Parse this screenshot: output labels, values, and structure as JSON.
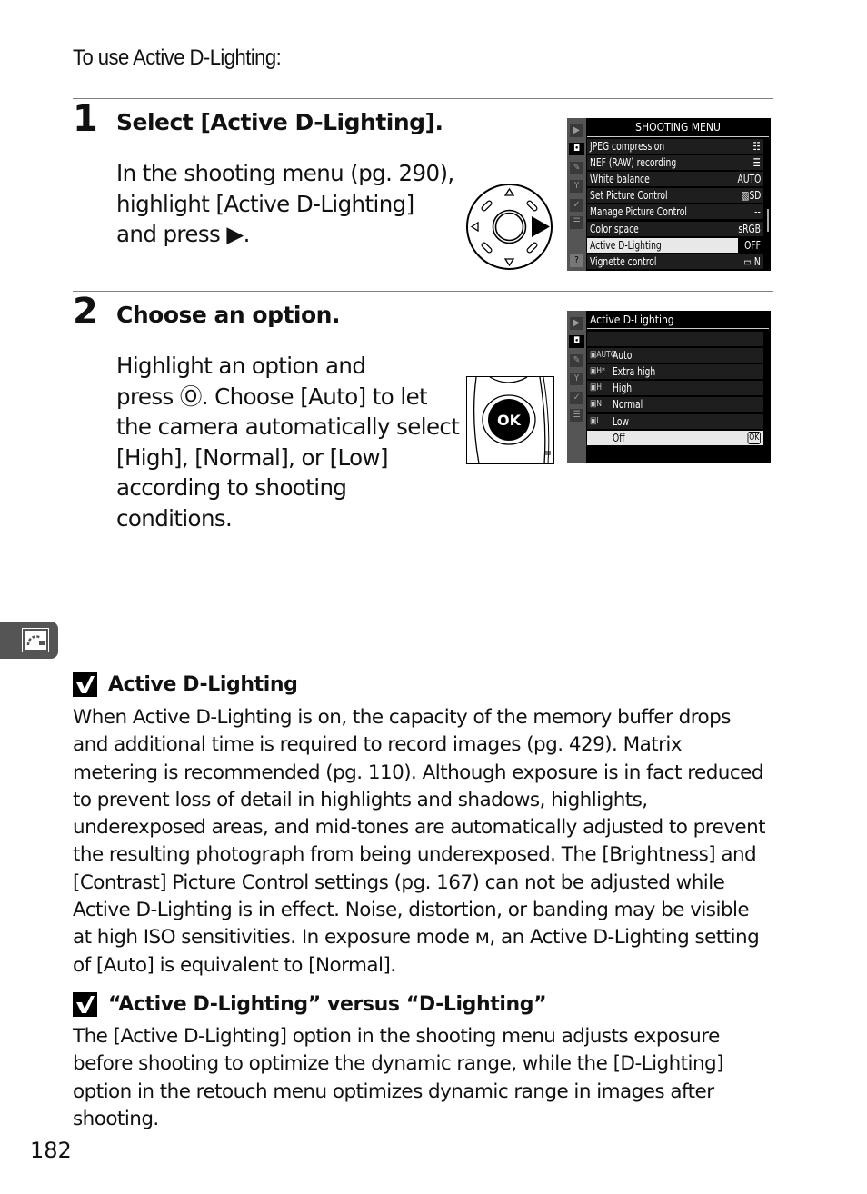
{
  "intro": "To use Active D-Lighting:",
  "steps": [
    {
      "number": "1",
      "title": "Select [Active D-Lighting].",
      "body_lines": [
        "In the shooting menu (pg. 290),",
        "highlight [Active D-Lighting]",
        "and press ▶."
      ]
    },
    {
      "number": "2",
      "title": "Choose an option.",
      "body_lines": [
        "Highlight an option and",
        "press Ⓞ. Choose [Auto] to let",
        "the camera automatically select",
        "[High], [Normal], or [Low]",
        "according to shooting",
        "conditions."
      ]
    }
  ],
  "shooting_menu": {
    "title": "SHOOTING MENU",
    "side_icons": [
      "playback-icon",
      "camera-icon",
      "pencil-icon",
      "wrench-icon",
      "retouch-icon",
      "my-menu-icon",
      "help-icon"
    ],
    "items": [
      {
        "label": "JPEG compression",
        "value": "☷"
      },
      {
        "label": "NEF (RAW) recording",
        "value": "☰"
      },
      {
        "label": "White balance",
        "value": "AUTO"
      },
      {
        "label": "Set Picture Control",
        "value": "▨SD"
      },
      {
        "label": "Manage Picture Control",
        "value": "--"
      },
      {
        "label": "Color space",
        "value": "sRGB"
      },
      {
        "label": "Active D-Lighting",
        "value": "OFF",
        "selected": true
      },
      {
        "label": "Vignette control",
        "value": "▭ N"
      }
    ]
  },
  "adl_menu": {
    "title": "Active D-Lighting",
    "items": [
      {
        "prefix": "▣AUTO",
        "label": "Auto"
      },
      {
        "prefix": "▣H*",
        "label": "Extra high"
      },
      {
        "prefix": "▣H",
        "label": "High"
      },
      {
        "prefix": "▣N",
        "label": "Normal"
      },
      {
        "prefix": "▣L",
        "label": "Low"
      },
      {
        "prefix": "",
        "label": "Off",
        "selected": true,
        "value": "OK"
      }
    ]
  },
  "multi_selector": {
    "pressed": "right"
  },
  "ok_button": {
    "label": "OK"
  },
  "notes": [
    {
      "title": "Active D-Lighting",
      "lines": [
        "When Active D-Lighting is on, the capacity of the memory buffer drops",
        "and additional time is required to record images (pg. 429).  Matrix",
        "metering is recommended (pg. 110).  Although exposure is in fact reduced",
        "to prevent loss of detail in highlights and shadows, highlights,",
        "underexposed areas, and mid-tones are automatically adjusted to prevent",
        "the resulting photograph from being underexposed.  The [Brightness] and",
        "[Contrast] Picture Control settings (pg. 167) can not be adjusted while",
        "Active D-Lighting is in effect.   Noise, distortion, or banding may be visible",
        "at high ISO sensitivities.  In exposure mode м, an Active D-Lighting setting",
        "of [Auto] is equivalent to [Normal]."
      ]
    },
    {
      "title": "“Active D-Lighting” versus “D-Lighting”",
      "lines": [
        "The [Active D-Lighting] option in the shooting menu adjusts exposure",
        "before shooting to optimize the dynamic range, while the [D-Lighting]",
        "option in the retouch menu optimizes dynamic range in images after",
        "shooting."
      ]
    }
  ],
  "page_number": "182"
}
